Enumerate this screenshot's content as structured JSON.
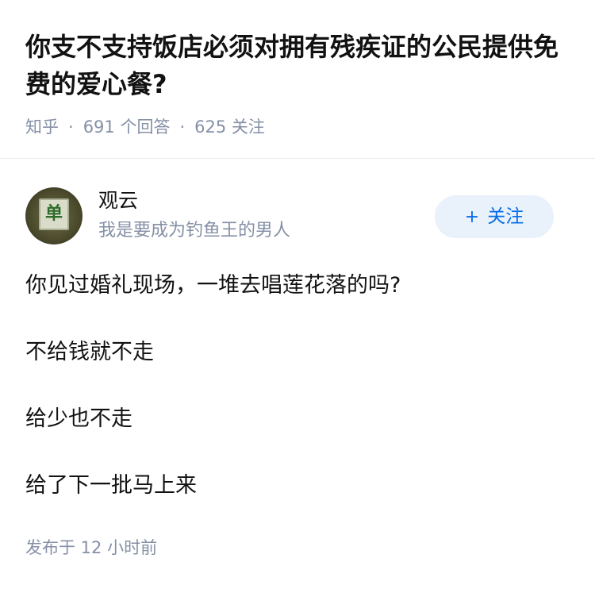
{
  "question": {
    "title": "你支不支持饭店必须对拥有残疾证的公民提供免费的爱心餐?",
    "meta": {
      "source": "知乎",
      "separator": "·",
      "answers": "691 个回答",
      "followers": "625 关注"
    }
  },
  "answer": {
    "author": {
      "name": "观云",
      "bio": "我是要成为钓鱼王的男人",
      "avatar_glyph": "单"
    },
    "follow_button": {
      "icon": "+",
      "label": "关注"
    },
    "paragraphs": [
      "你见过婚礼现场，一堆去唱莲花落的吗?",
      "不给钱就不走",
      "给少也不走",
      "给了下一批马上来"
    ],
    "publish_time": "发布于 12 小时前"
  },
  "colors": {
    "title": "#121212",
    "meta": "#8590a6",
    "accent": "#056de8",
    "follow_bg": "#e9f1fb",
    "divider": "#ebebeb"
  }
}
